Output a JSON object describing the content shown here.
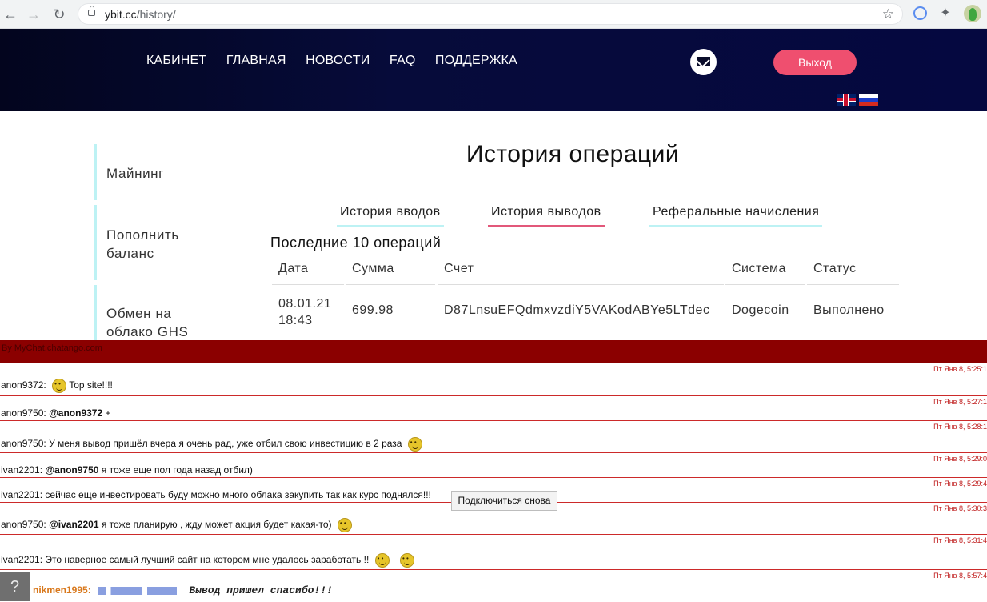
{
  "browser": {
    "url_host": "ybit.cc",
    "url_path": "/history/"
  },
  "header": {
    "menu": [
      "КАБИНЕТ",
      "ГЛАВНАЯ",
      "НОВОСТИ",
      "FAQ",
      "ПОДДЕРЖКА"
    ],
    "logout_label": "Выход",
    "colors": {
      "background": "#060b3a",
      "logout": "#ef4f6f"
    }
  },
  "sidebar": {
    "items": [
      {
        "label": "Майнинг"
      },
      {
        "label": "Пополнить баланс"
      },
      {
        "label": "Обмен на облако GHS"
      }
    ]
  },
  "main": {
    "title": "История операций",
    "tabs": [
      {
        "label": "История вводов",
        "active": false
      },
      {
        "label": "История выводов",
        "active": true
      },
      {
        "label": "Реферальные начисления",
        "active": false
      }
    ],
    "subtitle": "Последние 10 операций",
    "table": {
      "headers": [
        "Дата",
        "Сумма",
        "Счет",
        "Система",
        "Статус"
      ],
      "rows": [
        {
          "date": "08.01.21",
          "time": "18:43",
          "amount": "699.98",
          "account": "D87LnsuEFQdmxvzdiY5VAKodABYe5LTdec",
          "system": "Dogecoin",
          "status": "Выполнено"
        }
      ]
    }
  },
  "chat": {
    "header": "By MyChat.chatango.com",
    "reconnect_label": "Подключиться снова",
    "help_label": "?",
    "messages": [
      {
        "time": "Пт Янв 8, 5:25:1",
        "user": "anon9372:",
        "mention": "",
        "text": "Top site!!!!"
      },
      {
        "time": "Пт Янв 8, 5:27:1",
        "user": "anon9750:",
        "mention": "@anon9372",
        "text": "+"
      },
      {
        "time": "Пт Янв 8, 5:28:1",
        "user": "anon9750:",
        "mention": "",
        "text": "У меня вывод пришёл вчера я очень рад, уже отбил свою инвестицию в 2 раза"
      },
      {
        "time": "Пт Янв 8, 5:29:0",
        "user": "ivan2201:",
        "mention": "@anon9750",
        "text": "я тоже еще пол года назад отбил)"
      },
      {
        "time": "Пт Янв 8, 5:29:4",
        "user": "ivan2201:",
        "mention": "",
        "text": "сейчас еще инвестировать буду можно много облака закупить так как курс поднялся!!!"
      },
      {
        "time": "Пт Янв 8, 5:30:3",
        "user": "anon9750:",
        "mention": "@ivan2201",
        "text": "я тоже планирую , жду может акция будет какая-то)"
      },
      {
        "time": "Пт Янв 8, 5:31:4",
        "user": "ivan2201:",
        "mention": "",
        "text": "Это наверное самый лучший сайт на котором мне удалось заработать !!"
      },
      {
        "time": "Пт Янв 8, 5:57:4",
        "user": "nikmen1995:",
        "mention": "",
        "text": "Вывод пришел спасибо!!!"
      }
    ]
  }
}
